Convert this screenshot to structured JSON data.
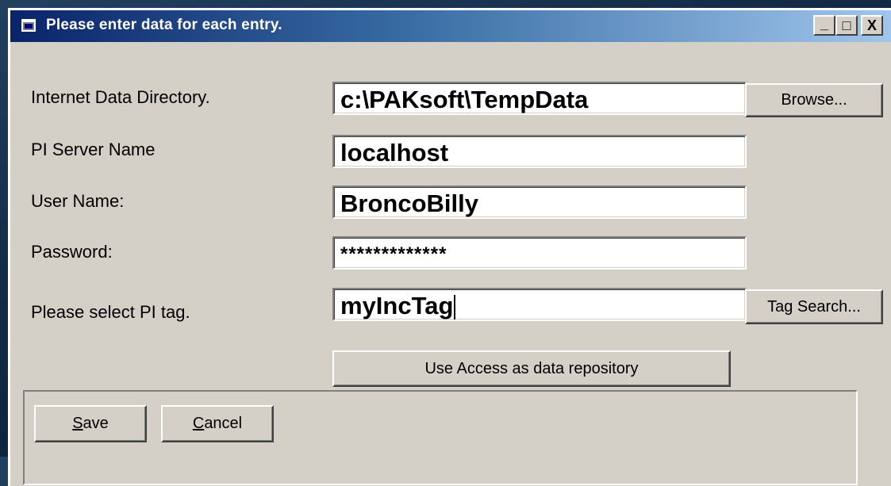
{
  "window": {
    "title": "Please enter data for each entry.",
    "controls": {
      "minimize": "_",
      "maximize": "□",
      "close": "X"
    }
  },
  "form": {
    "labels": {
      "data_dir": "Internet Data Directory.",
      "server": "PI Server Name",
      "user": "User Name:",
      "password": "Password:",
      "tag": "Please select PI tag."
    },
    "values": {
      "data_dir": "c:\\PAKsoft\\TempData",
      "server": "localhost",
      "user": "BroncoBilly",
      "password": "*************",
      "tag": "myIncTag"
    }
  },
  "buttons": {
    "browse": "Browse...",
    "tag_search": "Tag Search...",
    "use_access": "Use Access as data repository",
    "save_accel": "S",
    "save_rest": "ave",
    "cancel_accel": "C",
    "cancel_rest": "ancel"
  }
}
